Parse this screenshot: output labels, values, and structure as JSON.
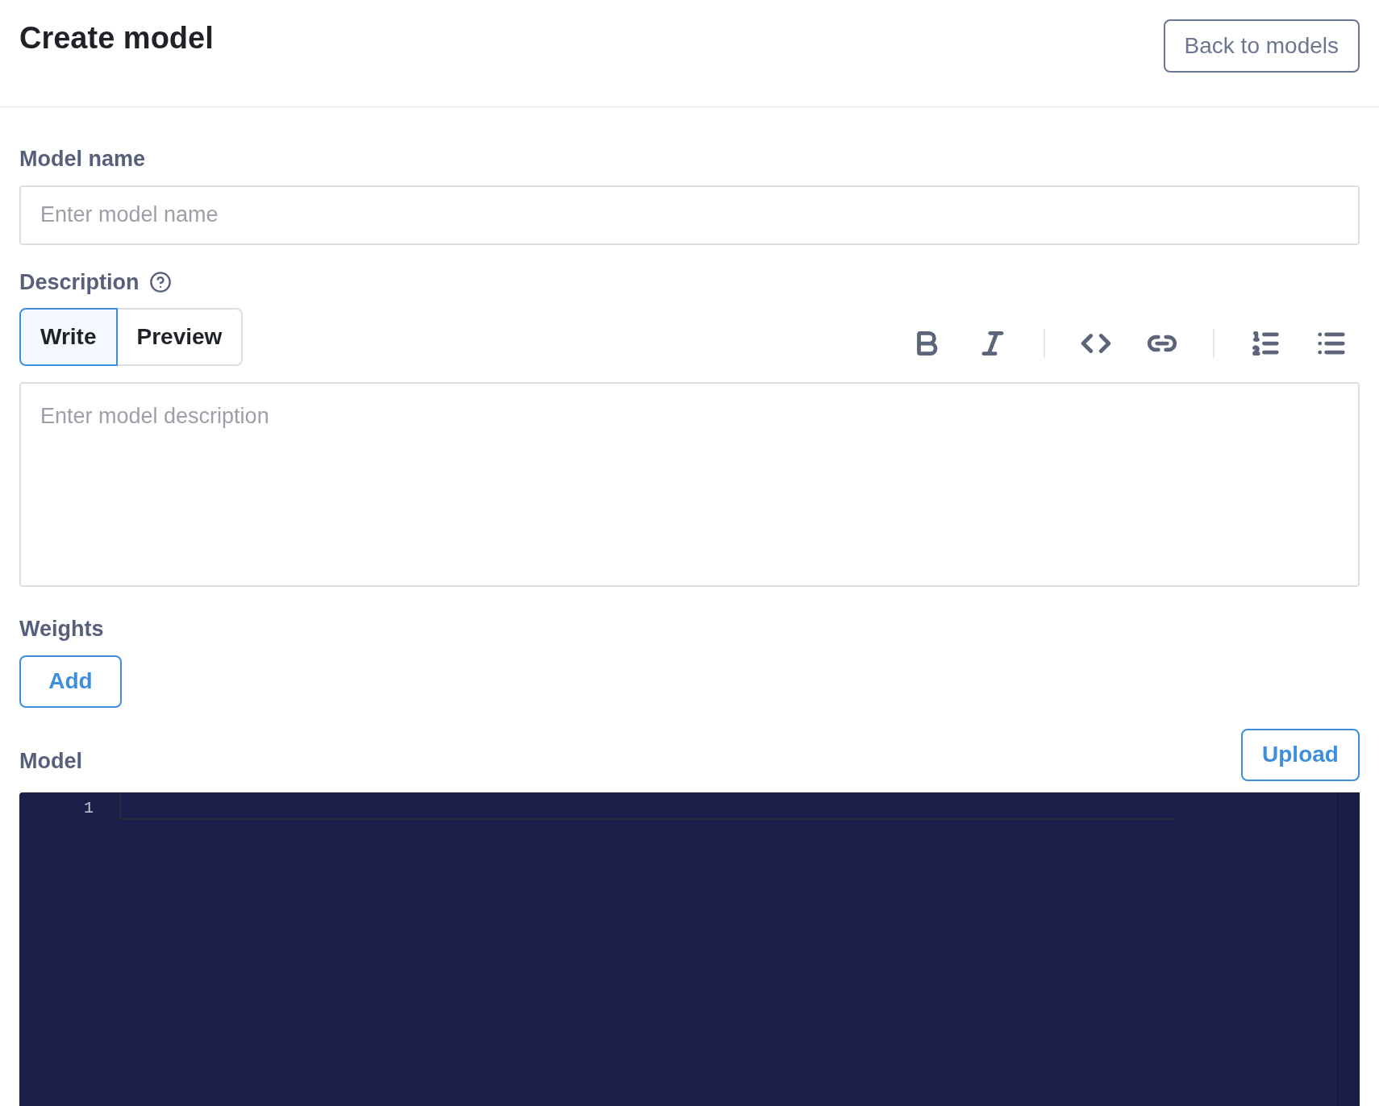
{
  "header": {
    "title": "Create model",
    "back_button": "Back to models"
  },
  "model_name": {
    "label": "Model name",
    "placeholder": "Enter model name"
  },
  "description": {
    "label": "Description",
    "tabs": [
      {
        "label": "Write",
        "selected": true
      },
      {
        "label": "Preview",
        "selected": false
      }
    ],
    "placeholder": "Enter model description"
  },
  "weights": {
    "label": "Weights",
    "add_button": "Add"
  },
  "model": {
    "label": "Model",
    "upload_button": "Upload",
    "line_numbers": [
      "1"
    ]
  }
}
